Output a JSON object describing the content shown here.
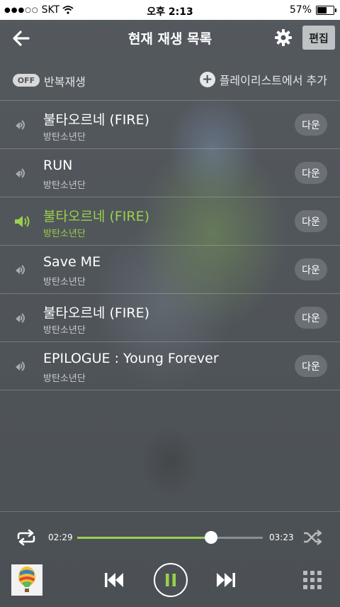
{
  "status_bar": {
    "carrier": "SKT",
    "signal_dots": "●●●○○",
    "time": "오후 2:13",
    "battery_percent": "57%",
    "battery_level": 0.57
  },
  "header": {
    "title": "현재 재생 목록",
    "edit_label": "편집"
  },
  "repeat": {
    "toggle_label": "OFF",
    "label": "반복재생",
    "add_playlist_label": "플레이리스트에서 추가"
  },
  "tracks": [
    {
      "title": "불타오르네 (FIRE)",
      "artist": "방탄소년단",
      "down_label": "다운",
      "active": false
    },
    {
      "title": "RUN",
      "artist": "방탄소년단",
      "down_label": "다운",
      "active": false
    },
    {
      "title": "불타오르네 (FIRE)",
      "artist": "방탄소년단",
      "down_label": "다운",
      "active": true
    },
    {
      "title": "Save ME",
      "artist": "방탄소년단",
      "down_label": "다운",
      "active": false
    },
    {
      "title": "불타오르네 (FIRE)",
      "artist": "방탄소년단",
      "down_label": "다운",
      "active": false
    },
    {
      "title": "EPILOGUE : Young Forever",
      "artist": "방탄소년단",
      "down_label": "다운",
      "active": false
    }
  ],
  "player": {
    "elapsed": "02:29",
    "total": "03:23",
    "progress_fraction": 0.72
  },
  "colors": {
    "accent": "#9ad04a",
    "background": "#4d5257",
    "edit_button": "#bfc2c4"
  }
}
